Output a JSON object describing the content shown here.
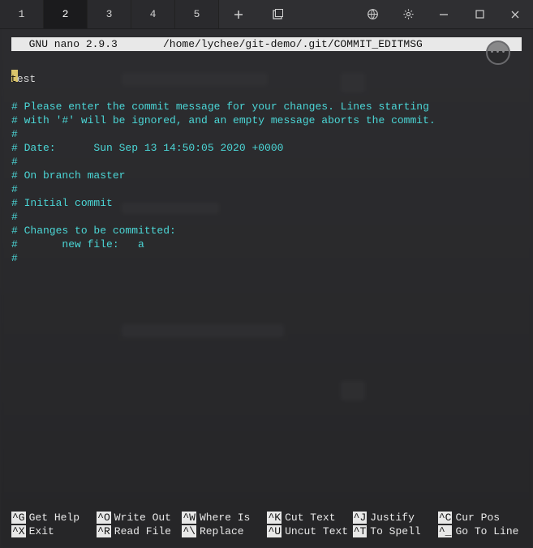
{
  "titlebar": {
    "tabs": [
      "1",
      "2",
      "3",
      "4",
      "5"
    ],
    "active_tab_index": 1
  },
  "nano": {
    "title": "  GNU nano 2.9.3",
    "path": "/home/lychee/git-demo/.git/COMMIT_EDITMSG"
  },
  "editor": {
    "first_char": "t",
    "rest_first_line": "est",
    "lines": [
      "",
      "# Please enter the commit message for your changes. Lines starting",
      "# with '#' will be ignored, and an empty message aborts the commit.",
      "#",
      "# Date:      Sun Sep 13 14:50:05 2020 +0000",
      "#",
      "# On branch master",
      "#",
      "# Initial commit",
      "#",
      "# Changes to be committed:",
      "#       new file:   a",
      "#"
    ]
  },
  "shortcuts": [
    {
      "key": "^G",
      "label": "Get Help"
    },
    {
      "key": "^O",
      "label": "Write Out"
    },
    {
      "key": "^W",
      "label": "Where Is"
    },
    {
      "key": "^K",
      "label": "Cut Text"
    },
    {
      "key": "^J",
      "label": "Justify"
    },
    {
      "key": "^C",
      "label": "Cur Pos"
    },
    {
      "key": "^X",
      "label": "Exit"
    },
    {
      "key": "^R",
      "label": "Read File"
    },
    {
      "key": "^\\",
      "label": "Replace"
    },
    {
      "key": "^U",
      "label": "Uncut Text"
    },
    {
      "key": "^T",
      "label": "To Spell"
    },
    {
      "key": "^_",
      "label": "Go To Line"
    }
  ],
  "circle_btn": "•••"
}
